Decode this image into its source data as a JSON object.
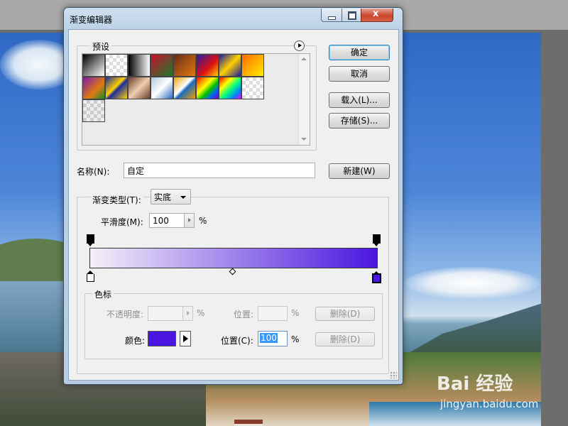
{
  "background": {
    "watermark": "Bai 经验",
    "watermark_sub": "jingyan.baidu.com"
  },
  "dialog": {
    "title": "渐变编辑器",
    "close_glyph": "x",
    "presets_label": "预设",
    "presets": [
      "linear-gradient(135deg,#000 0%,#fff 100%)",
      "repeating-conic-gradient(#ddd 0 25%,#fff 0 50%) 0 0/10px 10px",
      "linear-gradient(90deg,#000 0%,#fff 100%)",
      "linear-gradient(135deg,#c8102e 0%,#1a7a2a 100%)",
      "linear-gradient(135deg,#6a2a1a 0%,#e07a10 100%)",
      "linear-gradient(135deg,#2a1aa0 0%,#e01010 60%,#ffd000 100%)",
      "linear-gradient(135deg,#1a1aa0 0%,#ffd000 50%,#1a1aa0 100%)",
      "linear-gradient(135deg,#ff6a00 0%,#ffee00 100%)",
      "linear-gradient(135deg,#7a1ab0 0%,#e07a10 60%,#1a8a2a 100%)",
      "linear-gradient(135deg,#1a2aa0 0%,#ffd000 45%,#1a2aa0 55%,#ffd000 100%)",
      "linear-gradient(135deg,#6a3a2a 0%,#f0d0b0 50%,#6a3a2a 100%)",
      "linear-gradient(135deg,#b0c8e0 0%,#ffffff 50%,#2a6ac0 100%)",
      "linear-gradient(135deg,#f0a000 0%,#ffffff 45%,#1a6ac0 55%,#f0a000 100%)",
      "linear-gradient(135deg,#ff0000,#ff8c00,#ffff00,#00c000,#0060ff,#8000c0)",
      "linear-gradient(135deg,#ff0000 0%,#ffff00 30%,#00ff80 55%,#0080ff 80%,#ff00ff 100%)",
      "repeating-conic-gradient(#ddd 0 25%,#fff 0 50%) 0 0/10px 10px",
      "repeating-conic-gradient(#ccc 0 25%,#eee 0 50%) 0 0/10px 10px"
    ],
    "buttons": {
      "ok": "确定",
      "cancel": "取消",
      "load": "载入(L)...",
      "save": "存储(S)...",
      "new": "新建(W)"
    },
    "name_label": "名称(N):",
    "name_value": "自定",
    "gradient_type_label": "渐变类型(T):",
    "gradient_type_value": "实底",
    "smoothness_label": "平滑度(M):",
    "smoothness_value": "100",
    "smoothness_unit": "%",
    "gradient": {
      "start_color": "#f5f0f8",
      "end_color": "#4a16e0"
    },
    "stops": {
      "label": "色标",
      "opacity_label": "不透明度:",
      "opacity_unit": "%",
      "location1_label": "位置:",
      "location1_unit": "%",
      "delete1": "删除(D)",
      "color_label": "颜色:",
      "color_value": "#4a16e0",
      "location2_label": "位置(C):",
      "location2_value": "100",
      "location2_unit": "%",
      "delete2": "删除(D)"
    }
  }
}
